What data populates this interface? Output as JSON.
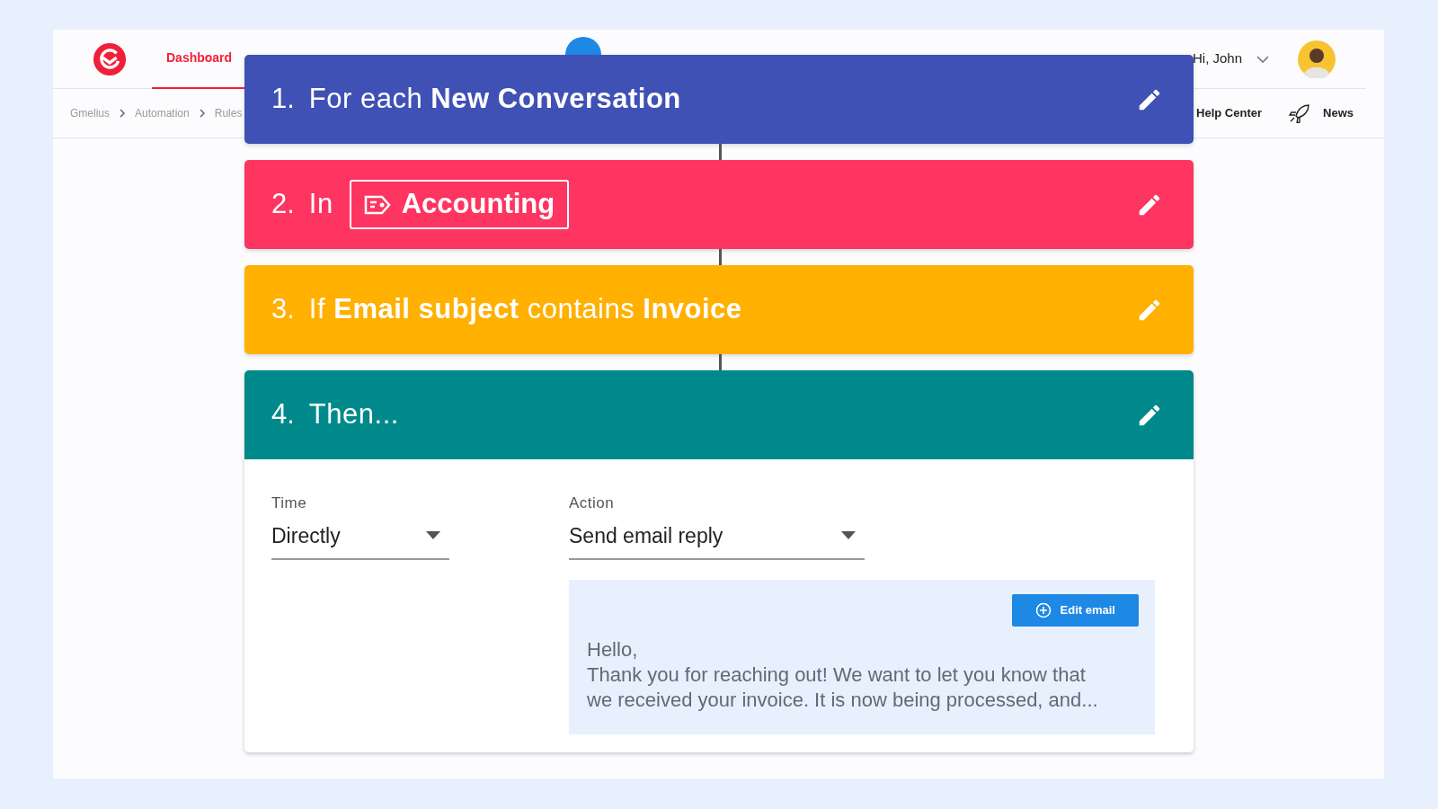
{
  "header": {
    "nav": [
      {
        "label": "Dashboard",
        "selected": true
      }
    ],
    "greeting": "Hi, John",
    "breadcrumb": [
      "Gmelius",
      "Automation",
      "Rules"
    ],
    "links": [
      {
        "label": "Help Center",
        "kind": "help"
      },
      {
        "label": "News",
        "kind": "news"
      }
    ]
  },
  "steps": [
    {
      "number": "1.",
      "kind": "text",
      "text": "For each **New Conversation**",
      "color": "#3f51b5"
    },
    {
      "number": "2.",
      "kind": "tag",
      "text": "In",
      "tag": "Accounting",
      "color": "#fe3461"
    },
    {
      "number": "3.",
      "kind": "text",
      "text": "If **Email subject** contains **Invoice**",
      "color": "#ffb000"
    },
    {
      "number": "4.",
      "kind": "text",
      "text": "Then...",
      "color": "#00898a"
    }
  ],
  "action_panel": {
    "fields": [
      {
        "label": "Time",
        "value": "Directly"
      },
      {
        "label": "Action",
        "value": "Send email reply"
      }
    ],
    "email": {
      "button": "Edit email",
      "lines": [
        "Hello,",
        "Thank you for reaching out! We want to let you know that",
        "we received your invoice. It is now being processed, and..."
      ]
    }
  }
}
